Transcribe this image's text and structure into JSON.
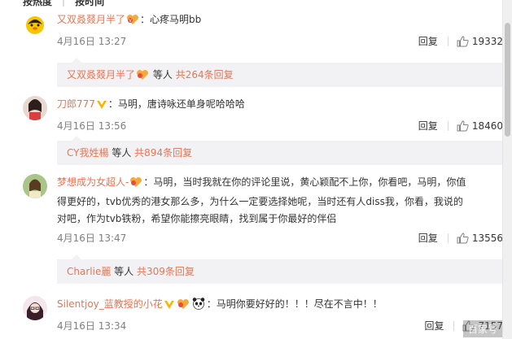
{
  "sort_tabs": [
    "按热度",
    "按时间"
  ],
  "comments": [
    {
      "username": "又双叒叕月半了",
      "text": "：心疼马明bb",
      "date": "4月16日 13:27",
      "reply_label": "回复",
      "likes": "19332",
      "reply_summary": {
        "name": "又双叒叕月半了",
        "middle": "等人",
        "count": "共264条回复"
      }
    },
    {
      "username": "刀郎777",
      "text": "：马明，唐诗咏还单身呢哈哈哈",
      "date": "4月16日 13:56",
      "reply_label": "回复",
      "likes": "18460",
      "reply_summary": {
        "name": "CY我姓楊",
        "middle": "等人",
        "count": "共894条回复"
      }
    },
    {
      "username": "梦想成为女超人-",
      "text_line1": "：马明，当时我就在你的评论里说，黄心颖配不上你，你看吧，马明，你值",
      "text_line2": "得更好的，tvb优秀的港女那么多，为什么一定要选择她呢，当时还有人diss我，你看，我说的",
      "text_line3": "对吧，作为tvb铁粉，希望你能擦亮眼睛，找到属于你最好的伴侣",
      "date": "4月16日 13:47",
      "reply_label": "回复",
      "likes": "13556",
      "reply_summary": {
        "name": "Charlie麗",
        "middle": "等人",
        "count": "共309条回复"
      }
    },
    {
      "username": "Silentjoy_蓝教授的小花",
      "text": "：马明你要好好的！！！尽在不言中！！",
      "date": "4月16日 13:34",
      "reply_label": "回复",
      "likes": "7157"
    }
  ],
  "watermark": "百家号",
  "colors": {
    "link": "#eb7350",
    "reply_bg": "#f2f2f5",
    "date": "#808080"
  }
}
